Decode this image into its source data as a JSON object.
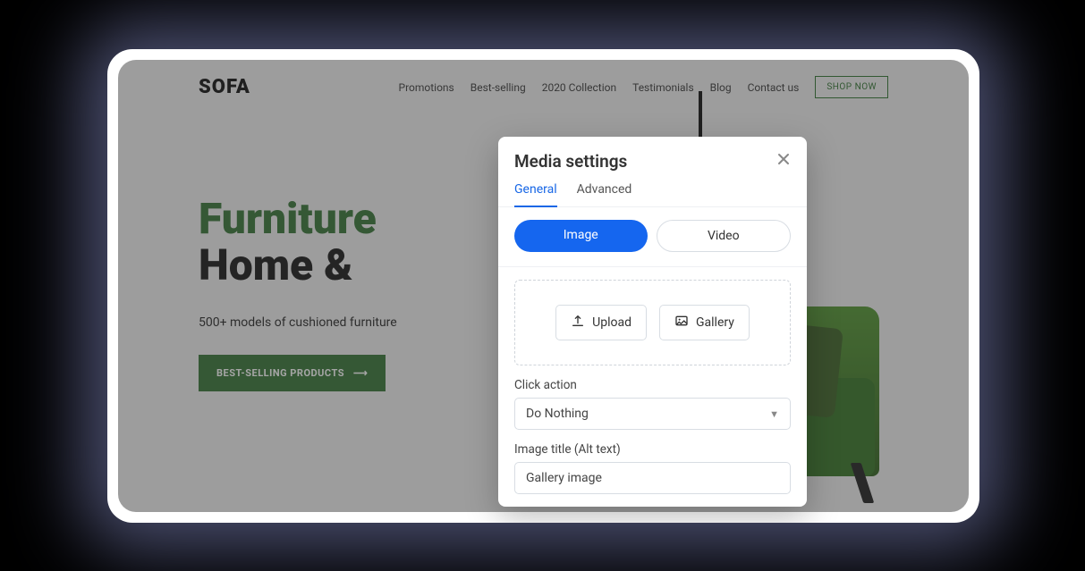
{
  "site": {
    "logo": "SOFA",
    "nav": {
      "promotions": "Promotions",
      "best_selling": "Best-selling",
      "collection": "2020 Collection",
      "testimonials": "Testimonials",
      "blog": "Blog",
      "contact": "Contact us",
      "shop_now": "SHOP NOW"
    },
    "hero": {
      "line1": "Furniture",
      "line2": "Home &",
      "subtitle": "500+ models of cushioned furniture",
      "cta": "BEST-SELLING PRODUCTS",
      "cta_arrow": "⟶"
    }
  },
  "modal": {
    "title": "Media settings",
    "tabs": {
      "general": "General",
      "advanced": "Advanced"
    },
    "media_type": {
      "image": "Image",
      "video": "Video"
    },
    "dropzone": {
      "upload": "Upload",
      "gallery": "Gallery"
    },
    "click_action": {
      "label": "Click action",
      "value": "Do Nothing"
    },
    "alt_text": {
      "label": "Image title (Alt text)",
      "value": "Gallery image"
    }
  }
}
